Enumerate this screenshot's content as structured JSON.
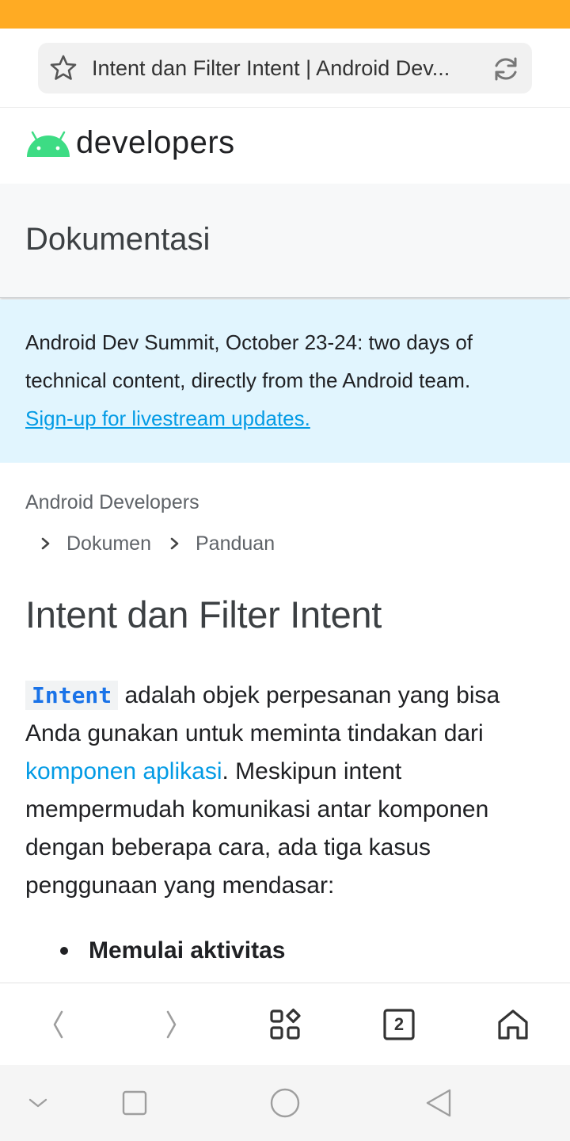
{
  "browser": {
    "tab_title": "Intent dan Filter Intent  |  Android Dev...",
    "tab_count": "2",
    "icons": {
      "bookmark": "star-icon",
      "reload": "reload-icon",
      "back": "back-arrow-icon",
      "forward": "forward-arrow-icon",
      "apps": "apps-grid-icon",
      "tabs": "tabs-counter-icon",
      "home": "home-icon"
    }
  },
  "site": {
    "logo_text": "developers",
    "section_title": "Dokumentasi"
  },
  "banner": {
    "text": "Android Dev Summit, October 23-24: two days of technical content, directly from the Android team.",
    "link": "Sign-up for livestream updates."
  },
  "breadcrumb": {
    "root": "Android Developers",
    "items": [
      "Dokumen",
      "Panduan"
    ]
  },
  "article": {
    "title": "Intent dan Filter Intent",
    "intro_code": "Intent",
    "intro_part1": " adalah objek perpesanan yang bisa Anda gunakan untuk meminta tindakan dari ",
    "intro_link": "komponen aplikasi",
    "intro_part2": ". Meskipun intent mempermudah komunikasi antar komponen dengan beberapa cara, ada tiga kasus penggunaan yang mendasar:",
    "bullets": [
      "Memulai aktivitas"
    ]
  },
  "colors": {
    "status_bar": "#ffab23",
    "android_green": "#3ddc84",
    "link_blue": "#039be5",
    "banner_bg": "#e1f5fe"
  }
}
